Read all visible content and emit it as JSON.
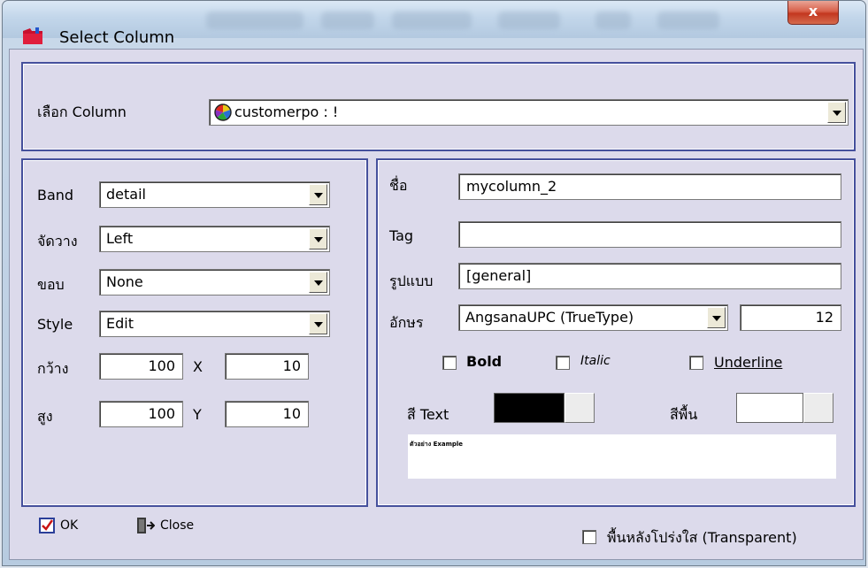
{
  "window": {
    "title": "Select Column",
    "close_glyph": "x"
  },
  "select_column": {
    "label": "เลือก Column",
    "value": "customerpo : !"
  },
  "left": {
    "band": {
      "label": "Band",
      "value": "detail"
    },
    "align": {
      "label": "จัดวาง",
      "value": "Left"
    },
    "border": {
      "label": "ขอบ",
      "value": "None"
    },
    "style": {
      "label": "Style",
      "value": "Edit"
    },
    "width": {
      "label": "กว้าง",
      "value": "100"
    },
    "x": {
      "label": "X",
      "value": "10"
    },
    "height": {
      "label": "สูง",
      "value": "100"
    },
    "y": {
      "label": "Y",
      "value": "10"
    }
  },
  "right": {
    "name": {
      "label": "ชื่อ",
      "value": "mycolumn_2"
    },
    "tag": {
      "label": "Tag",
      "value": ""
    },
    "format": {
      "label": "รูปแบบ",
      "value": "[general]"
    },
    "font": {
      "label": "อักษร",
      "value": "AngsanaUPC (TrueType)",
      "size": "12"
    },
    "bold_label": "Bold",
    "italic_label": "Italic",
    "underline_label": "Underline",
    "text_color": {
      "label": "สี Text",
      "color": "#000000"
    },
    "bg_color": {
      "label": "สีพื้น",
      "color": "#ffffff"
    },
    "preview_text": "ตัวอย่าง Example"
  },
  "footer": {
    "ok_label": "OK",
    "close_label": "Close",
    "transparent_label": "พื้นหลังโปร่งใส (Transparent)"
  },
  "icons": {
    "app": "folder-icon",
    "column": "color-wheel-icon",
    "ok": "check-icon",
    "close": "door-exit-icon"
  },
  "colors": {
    "panel_border": "#45509c",
    "client_bg": "#dcdaeb",
    "close_button": "#c3371f"
  }
}
